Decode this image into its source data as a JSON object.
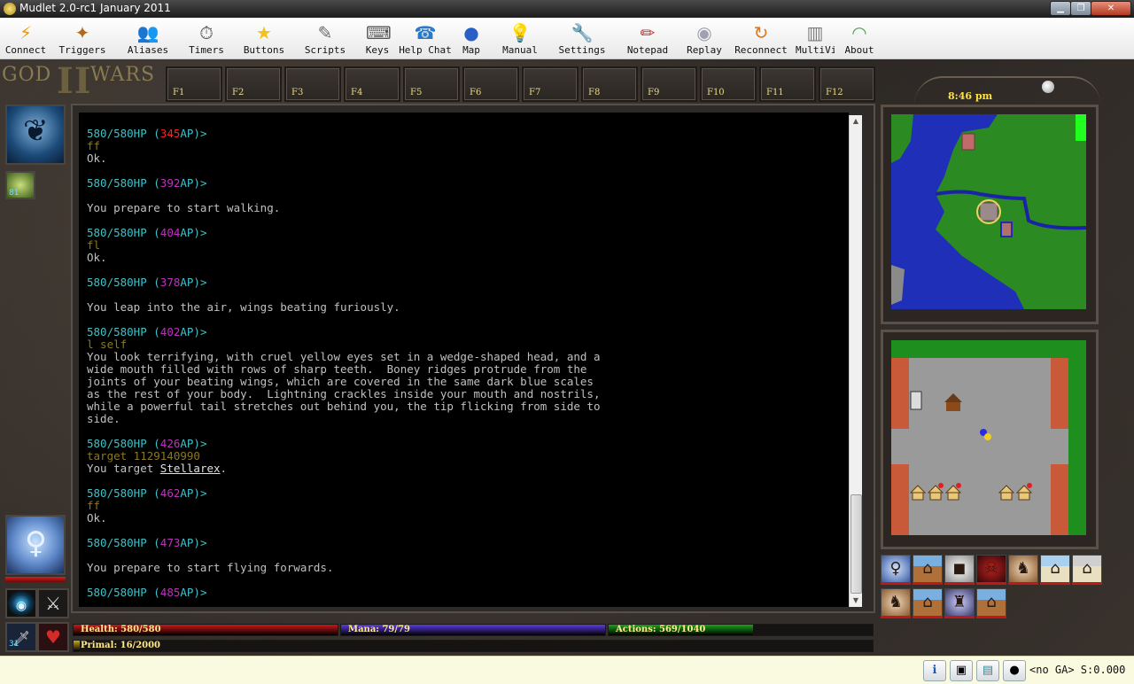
{
  "window": {
    "title": "Mudlet 2.0-rc1 January 2011"
  },
  "toolbar": [
    {
      "name": "connect",
      "label": "Connect",
      "icon": "⚡",
      "color": "#e89a14"
    },
    {
      "name": "triggers",
      "label": "Triggers",
      "icon": "✦",
      "color": "#b06a20"
    },
    {
      "name": "aliases",
      "label": "Aliases",
      "icon": "👥",
      "color": "#7a5a3a"
    },
    {
      "name": "timers",
      "label": "Timers",
      "icon": "⏱",
      "color": "#555555"
    },
    {
      "name": "buttons",
      "label": "Buttons",
      "icon": "★",
      "color": "#f2c21a"
    },
    {
      "name": "scripts",
      "label": "Scripts",
      "icon": "✎",
      "color": "#6a6a6a"
    },
    {
      "name": "keys",
      "label": "Keys",
      "icon": "⌨",
      "color": "#555555"
    },
    {
      "name": "help-chat",
      "label": "Help Chat",
      "icon": "☎",
      "color": "#2a7ac8"
    },
    {
      "name": "map",
      "label": "Map",
      "icon": "●",
      "color": "#2a5fc8"
    },
    {
      "name": "manual",
      "label": "Manual",
      "icon": "💡",
      "color": "#e0b820"
    },
    {
      "name": "settings",
      "label": "Settings",
      "icon": "🔧",
      "color": "#6a6a6a"
    },
    {
      "name": "notepad",
      "label": "Notepad",
      "icon": "✏",
      "color": "#c03030"
    },
    {
      "name": "replay",
      "label": "Replay",
      "icon": "◉",
      "color": "#a0a0b0"
    },
    {
      "name": "reconnect",
      "label": "Reconnect",
      "icon": "↻",
      "color": "#e0781a"
    },
    {
      "name": "multiview",
      "label": "MultiView",
      "icon": "▥",
      "color": "#7a7a7a"
    },
    {
      "name": "about",
      "label": "About",
      "icon": "◠",
      "color": "#50a050"
    }
  ],
  "logo": {
    "left": "GOD",
    "numeral": "II",
    "right": "WARS"
  },
  "fkeys": [
    "F1",
    "F2",
    "F3",
    "F4",
    "F5",
    "F6",
    "F7",
    "F8",
    "F9",
    "F10",
    "F11",
    "F12"
  ],
  "console": {
    "lines": [
      [
        {
          "t": "580/580HP (",
          "c": "hp"
        },
        {
          "t": "345",
          "c": "red"
        },
        {
          "t": "AP)>",
          "c": "hp"
        }
      ],
      [
        {
          "t": "ff",
          "c": "cmd"
        }
      ],
      [
        {
          "t": "Ok.",
          "c": "gray"
        }
      ],
      [],
      [
        {
          "t": "580/580HP (",
          "c": "hp"
        },
        {
          "t": "392",
          "c": "ap"
        },
        {
          "t": "AP)>",
          "c": "hp"
        }
      ],
      [],
      [
        {
          "t": "You prepare to start walking.",
          "c": "gray"
        }
      ],
      [],
      [
        {
          "t": "580/580HP (",
          "c": "hp"
        },
        {
          "t": "404",
          "c": "ap"
        },
        {
          "t": "AP)>",
          "c": "hp"
        }
      ],
      [
        {
          "t": "fl",
          "c": "cmd"
        }
      ],
      [
        {
          "t": "Ok.",
          "c": "gray"
        }
      ],
      [],
      [
        {
          "t": "580/580HP (",
          "c": "hp"
        },
        {
          "t": "378",
          "c": "ap"
        },
        {
          "t": "AP)>",
          "c": "hp"
        }
      ],
      [],
      [
        {
          "t": "You leap into the air, wings beating furiously.",
          "c": "gray"
        }
      ],
      [],
      [
        {
          "t": "580/580HP (",
          "c": "hp"
        },
        {
          "t": "402",
          "c": "ap"
        },
        {
          "t": "AP)>",
          "c": "hp"
        }
      ],
      [
        {
          "t": "l self",
          "c": "cmd"
        }
      ],
      [
        {
          "t": "You look terrifying, with cruel yellow eyes set in a wedge-shaped head, and a",
          "c": "gray"
        }
      ],
      [
        {
          "t": "wide mouth filled with rows of sharp teeth.  Boney ridges protrude from the",
          "c": "gray"
        }
      ],
      [
        {
          "t": "joints of your beating wings, which are covered in the same dark blue scales",
          "c": "gray"
        }
      ],
      [
        {
          "t": "as the rest of your body.  Lightning crackles inside your mouth and nostrils,",
          "c": "gray"
        }
      ],
      [
        {
          "t": "while a powerful tail stretches out behind you, the tip flicking from side to",
          "c": "gray"
        }
      ],
      [
        {
          "t": "side.",
          "c": "gray"
        }
      ],
      [],
      [
        {
          "t": "580/580HP (",
          "c": "hp"
        },
        {
          "t": "426",
          "c": "ap"
        },
        {
          "t": "AP)>",
          "c": "hp"
        }
      ],
      [
        {
          "t": "target 1129140990",
          "c": "cmd"
        }
      ],
      [
        {
          "t": "You target ",
          "c": "gray"
        },
        {
          "t": "Stellarex",
          "c": "link"
        },
        {
          "t": ".",
          "c": "gray"
        }
      ],
      [],
      [
        {
          "t": "580/580HP (",
          "c": "hp"
        },
        {
          "t": "462",
          "c": "ap"
        },
        {
          "t": "AP)>",
          "c": "hp"
        }
      ],
      [
        {
          "t": "ff",
          "c": "cmd"
        }
      ],
      [
        {
          "t": "Ok.",
          "c": "gray"
        }
      ],
      [],
      [
        {
          "t": "580/580HP (",
          "c": "hp"
        },
        {
          "t": "473",
          "c": "ap"
        },
        {
          "t": "AP)>",
          "c": "hp"
        }
      ],
      [],
      [
        {
          "t": "You prepare to start flying forwards.",
          "c": "gray"
        }
      ],
      [],
      [
        {
          "t": "580/580HP (",
          "c": "hp"
        },
        {
          "t": "485",
          "c": "ap"
        },
        {
          "t": "AP)>",
          "c": "hp"
        }
      ]
    ]
  },
  "sidebar": {
    "small_avatar_count": "81",
    "slot_badge": "31"
  },
  "stats": {
    "health": {
      "label": "Health: 580/580",
      "value": 580,
      "max": 580,
      "color": "#c81818"
    },
    "mana": {
      "label": "Mana: 79/79",
      "value": 79,
      "max": 79,
      "color": "#5a3ce0"
    },
    "actions": {
      "label": "Actions: 569/1040",
      "value": 569,
      "max": 1040,
      "color": "#1ca21c"
    },
    "primal": {
      "label": "Primal: 16/2000",
      "value": 16,
      "max": 2000,
      "color": "#c8a818"
    }
  },
  "clock": {
    "time": "8:46 pm"
  },
  "status": {
    "ga": "<no GA> S:0.000"
  }
}
